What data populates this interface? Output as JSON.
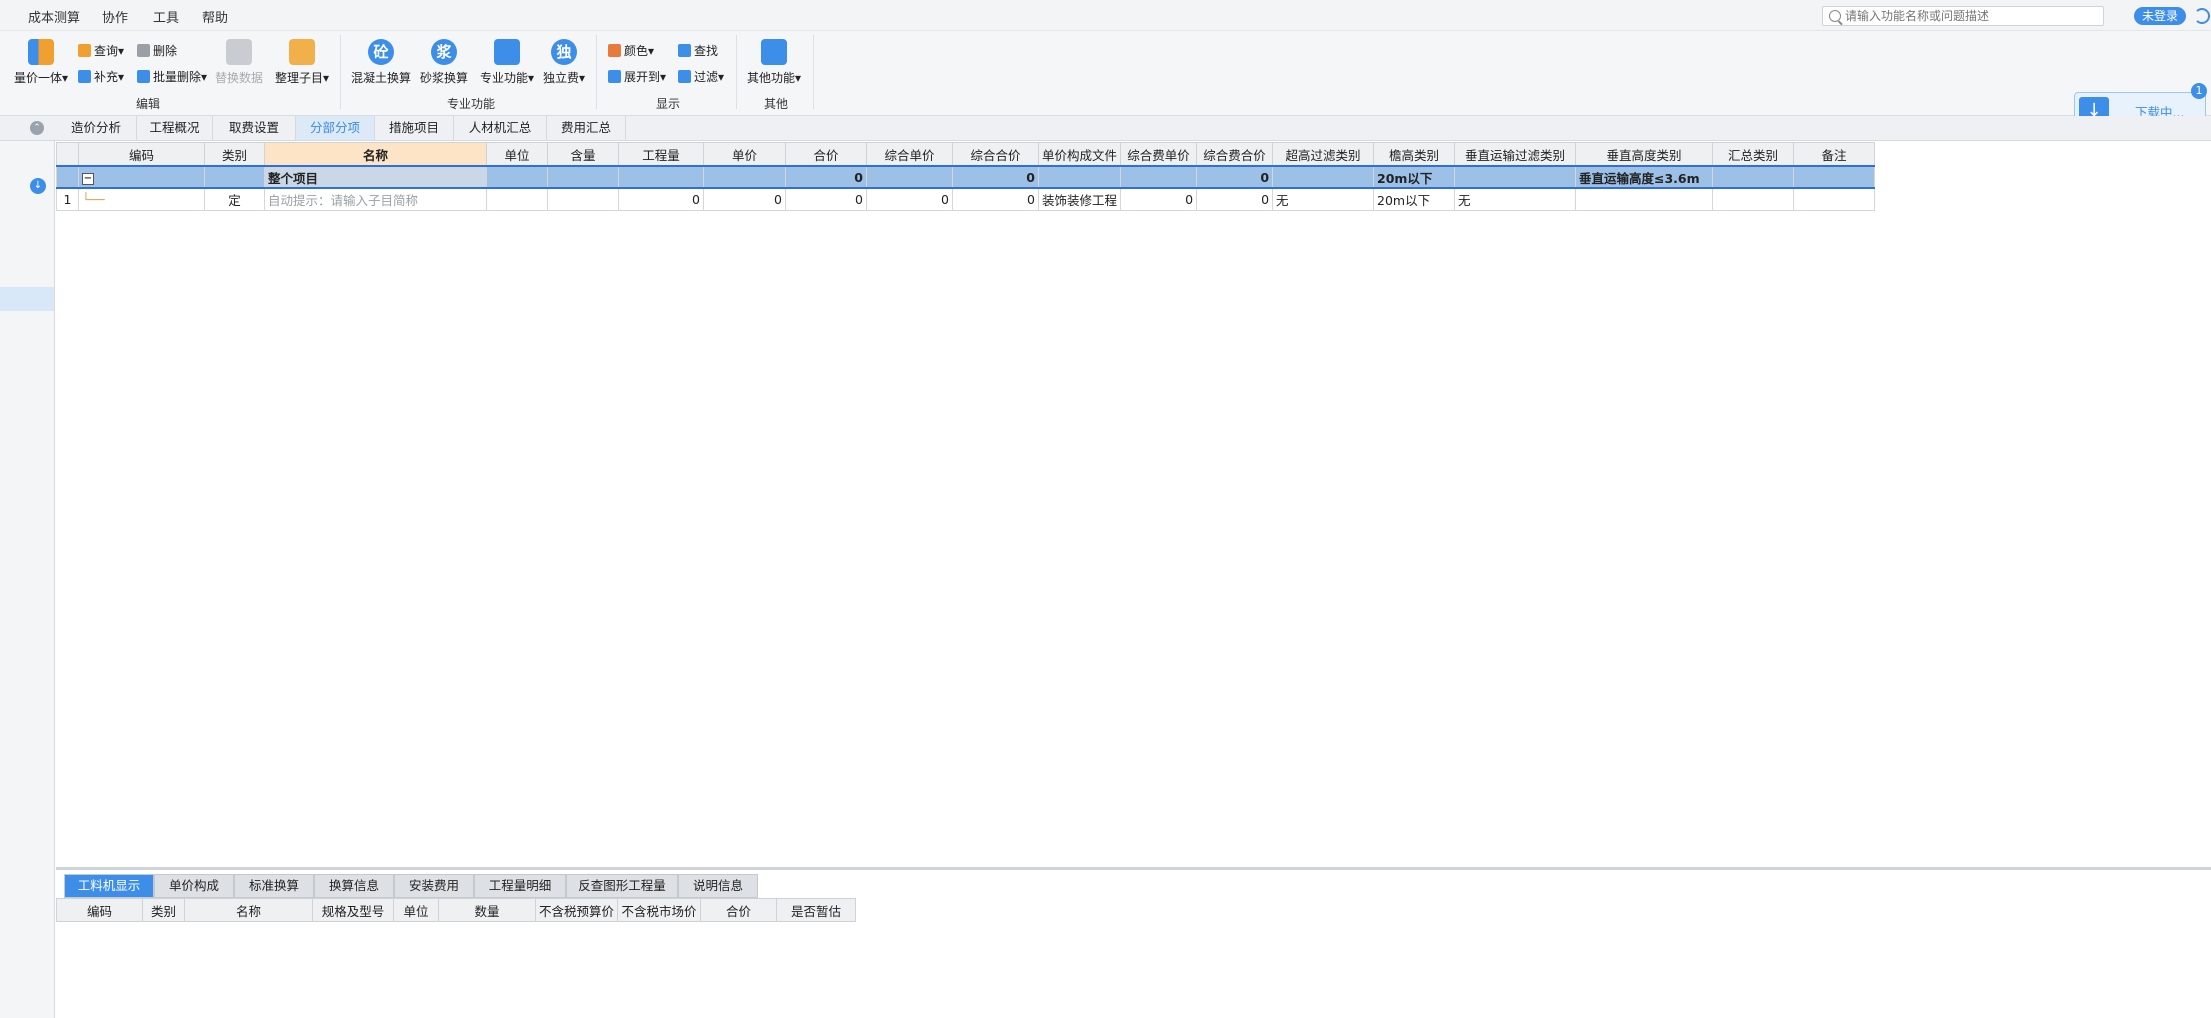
{
  "menu": {
    "items": [
      "成本测算",
      "协作",
      "工具",
      "帮助"
    ],
    "search_placeholder": "请输入功能名称或问题描述",
    "login_label": "未登录"
  },
  "ribbon": {
    "edit_group": {
      "label": "编辑",
      "liangjia": "量价一体",
      "query": "查询",
      "supplement": "补充",
      "delete": "删除",
      "batch_delete": "批量删除",
      "replace_data": "替换数据",
      "organize": "整理子目"
    },
    "special_group": {
      "label": "专业功能",
      "concrete": "混凝土换算",
      "concrete_glyph": "砼",
      "mortar": "砂浆换算",
      "mortar_glyph": "浆",
      "special": "专业功能",
      "independent": "独立费",
      "independent_glyph": "独"
    },
    "display_group": {
      "label": "显示",
      "color": "颜色",
      "expand": "展开到",
      "find": "查找",
      "filter": "过滤"
    },
    "other_group": {
      "label": "其他",
      "other": "其他功能"
    }
  },
  "tabs": [
    "造价分析",
    "工程概况",
    "取费设置",
    "分部分项",
    "措施项目",
    "人材机汇总",
    "费用汇总"
  ],
  "active_tab": "分部分项",
  "grid": {
    "headers": [
      "编码",
      "类别",
      "名称",
      "单位",
      "含量",
      "工程量",
      "单价",
      "合价",
      "综合单价",
      "综合合价",
      "单价构成文件",
      "综合费单价",
      "综合费合价",
      "超高过滤类别",
      "檐高类别",
      "垂直运输过滤类别",
      "垂直高度类别",
      "汇总类别",
      "备注"
    ],
    "group_row": {
      "toggle": "−",
      "name": "整个项目",
      "hejia": "0",
      "zonghe_hejia": "0",
      "zonghefei_hejia": "0",
      "yangao": "20m以下",
      "chuizhi_gaodu": "垂直运输高度≤3.6m"
    },
    "rows": [
      {
        "index": "1",
        "tree": "└──",
        "category": "定",
        "name_hint": "自动提示：请输入子目简称",
        "quantity": "0",
        "unit_price": "0",
        "total": "0",
        "comp_unit_price": "0",
        "comp_total": "0",
        "price_file": "装饰装修工程",
        "fee_unit": "0",
        "fee_total": "0",
        "chaogao": "无",
        "yangao": "20m以下",
        "chuizhi_filter": "无"
      }
    ]
  },
  "bottom": {
    "tabs": [
      "工料机显示",
      "单价构成",
      "标准换算",
      "换算信息",
      "安装费用",
      "工程量明细",
      "反查图形工程量",
      "说明信息"
    ],
    "active_tab": "工料机显示",
    "headers": [
      "编码",
      "类别",
      "名称",
      "规格及型号",
      "单位",
      "数量",
      "不含税预算价",
      "不含税市场价",
      "合价",
      "是否暂估"
    ]
  },
  "download": {
    "label": "下载中...",
    "badge": "1"
  },
  "colors": {
    "accent": "#3d8ee8",
    "group_row": "#9cc0e6",
    "name_header": "#fde4c6"
  }
}
